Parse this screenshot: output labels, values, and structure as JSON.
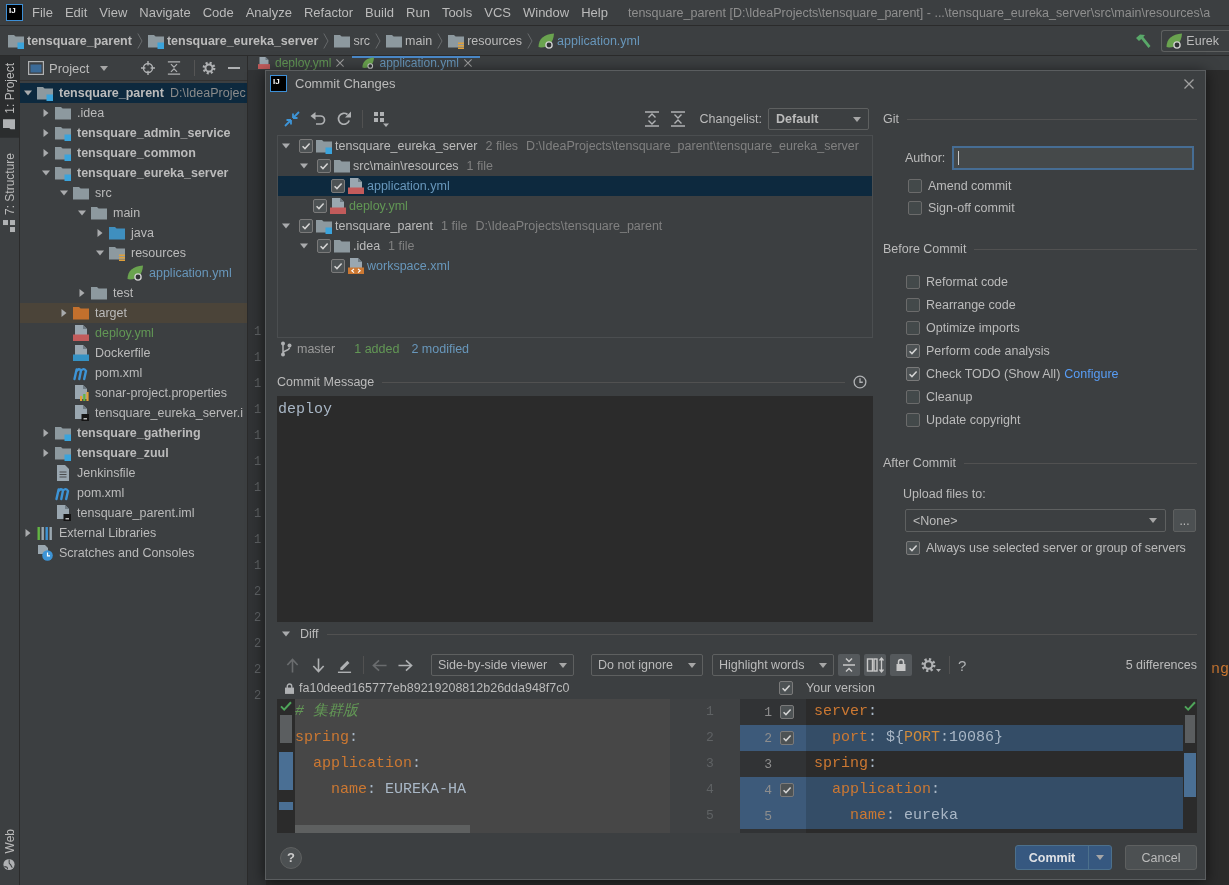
{
  "menu_bar": {
    "logo": "IJ",
    "items": [
      "File",
      "Edit",
      "View",
      "Navigate",
      "Code",
      "Analyze",
      "Refactor",
      "Build",
      "Run",
      "Tools",
      "VCS",
      "Window",
      "Help"
    ],
    "title": "tensquare_parent [D:\\IdeaProjects\\tensquare_parent] - ...\\tensquare_eureka_server\\src\\main\\resources\\a"
  },
  "navigation_bar": {
    "crumbs": [
      {
        "label": "tensquare_parent",
        "kind": "module"
      },
      {
        "label": "tensquare_eureka_server",
        "kind": "module"
      },
      {
        "label": "src",
        "kind": "folder"
      },
      {
        "label": "main",
        "kind": "folder"
      },
      {
        "label": "resources",
        "kind": "resources-folder"
      },
      {
        "label": "application.yml",
        "kind": "spring-yml",
        "color": "#6897bb"
      }
    ],
    "run_config": "Eurek"
  },
  "tool_strip": {
    "top": [
      {
        "label": "1: Project",
        "kind": "project",
        "selected": true
      },
      {
        "label": "7: Structure",
        "kind": "structure",
        "selected": false
      }
    ],
    "bottom": [
      {
        "label": "Web",
        "kind": "web",
        "selected": false
      }
    ]
  },
  "project": {
    "title": "Project",
    "tree": [
      {
        "label": "tensquare_parent",
        "kind": "module",
        "note": "D:\\IdeaProjec",
        "expanded": true,
        "selected": true,
        "children": [
          {
            "label": ".idea",
            "kind": "folder",
            "expanded": false,
            "selected": false
          },
          {
            "label": "tensquare_admin_service",
            "kind": "module",
            "expanded": false,
            "selected": false
          },
          {
            "label": "tensquare_common",
            "kind": "module",
            "expanded": false,
            "selected": false
          },
          {
            "label": "tensquare_eureka_server",
            "kind": "module",
            "expanded": true,
            "selected": false,
            "children": [
              {
                "label": "src",
                "kind": "folder",
                "expanded": true,
                "selected": false,
                "children": [
                  {
                    "label": "main",
                    "kind": "folder",
                    "expanded": true,
                    "selected": false,
                    "children": [
                      {
                        "label": "java",
                        "kind": "source-folder",
                        "expanded": false,
                        "selected": false
                      },
                      {
                        "label": "resources",
                        "kind": "resources-folder",
                        "expanded": true,
                        "selected": false,
                        "children": [
                          {
                            "label": "application.yml",
                            "kind": "spring-yml",
                            "color": "#6897bb",
                            "selected": false
                          }
                        ]
                      }
                    ]
                  },
                  {
                    "label": "test",
                    "kind": "folder",
                    "expanded": false,
                    "selected": false
                  }
                ]
              },
              {
                "label": "target",
                "kind": "excluded-folder",
                "expanded": false,
                "selected": false
              },
              {
                "label": "deploy.yml",
                "kind": "yml",
                "color": "#629755",
                "selected": false
              },
              {
                "label": "Dockerfile",
                "kind": "docker",
                "selected": false
              },
              {
                "label": "pom.xml",
                "kind": "maven",
                "selected": false
              },
              {
                "label": "sonar-project.properties",
                "kind": "properties",
                "selected": false
              },
              {
                "label": "tensquare_eureka_server.i",
                "kind": "iml",
                "selected": false
              }
            ]
          },
          {
            "label": "tensquare_gathering",
            "kind": "module",
            "expanded": false,
            "selected": false
          },
          {
            "label": "tensquare_zuul",
            "kind": "module",
            "expanded": false,
            "selected": false
          },
          {
            "label": "Jenkinsfile",
            "kind": "text",
            "selected": false
          },
          {
            "label": "pom.xml",
            "kind": "maven",
            "selected": false
          },
          {
            "label": "tensquare_parent.iml",
            "kind": "iml",
            "selected": false
          }
        ]
      },
      {
        "label": "External Libraries",
        "kind": "libraries",
        "expanded": false,
        "selected": false
      },
      {
        "label": "Scratches and Consoles",
        "kind": "scratches",
        "selected": false
      }
    ]
  },
  "editor": {
    "tabs": [
      {
        "label": "deploy.yml",
        "kind": "yml",
        "color": "#629755",
        "selected": false
      },
      {
        "label": "application.yml",
        "kind": "spring-yml",
        "color": "#6897bb",
        "selected": true
      }
    ],
    "lines": [
      {
        "number": "1"
      },
      {
        "number": "1"
      },
      {
        "number": "1"
      },
      {
        "number": "1"
      },
      {
        "number": "1"
      },
      {
        "number": "1"
      },
      {
        "number": "1"
      },
      {
        "number": "1"
      },
      {
        "number": "1"
      },
      {
        "number": "1"
      },
      {
        "number": "2"
      },
      {
        "number": "2"
      },
      {
        "number": "2"
      },
      {
        "number": "2",
        "code": "ng"
      },
      {
        "number": "2"
      }
    ]
  },
  "dialog": {
    "logo": "IJ",
    "title": "Commit Changes",
    "changelist_label": "Changelist:",
    "changelist": "Default",
    "changes_tree": [
      {
        "label": "tensquare_eureka_server",
        "kind": "module",
        "count": "2 files",
        "path": "D:\\IdeaProjects\\tensquare_parent\\tensquare_eureka_server",
        "checked": true,
        "expanded": true,
        "selected": false,
        "children": [
          {
            "label": "src\\main\\resources",
            "kind": "folder",
            "count": "1 file",
            "checked": true,
            "expanded": true,
            "selected": false,
            "children": [
              {
                "label": "application.yml",
                "kind": "yml",
                "color": "#6897bb",
                "checked": true,
                "selected": true
              }
            ]
          },
          {
            "label": "deploy.yml",
            "kind": "yml",
            "color": "#629755",
            "checked": true,
            "selected": false
          }
        ]
      },
      {
        "label": "tensquare_parent",
        "kind": "module",
        "count": "1 file",
        "path": "D:\\IdeaProjects\\tensquare_parent",
        "checked": true,
        "expanded": true,
        "selected": false,
        "children": [
          {
            "label": ".idea",
            "kind": "folder",
            "count": "1 file",
            "checked": true,
            "expanded": true,
            "selected": false,
            "children": [
              {
                "label": "workspace.xml",
                "kind": "xml",
                "color": "#6897bb",
                "checked": true,
                "selected": false
              }
            ]
          }
        ]
      }
    ],
    "branch": "master",
    "added": "1 added",
    "modified": "2 modified",
    "message_label": "Commit Message",
    "message": "deploy",
    "git": {
      "heading": "Git",
      "author": {
        "label": "Author:",
        "focused": true
      },
      "options": [
        {
          "label": "Amend commit",
          "checked": false
        },
        {
          "label": "Sign-off commit",
          "checked": false
        }
      ]
    },
    "before_commit": {
      "heading": "Before Commit",
      "options": [
        {
          "label": "Reformat code",
          "checked": false
        },
        {
          "label": "Rearrange code",
          "checked": false
        },
        {
          "label": "Optimize imports",
          "checked": false
        },
        {
          "label": "Perform code analysis",
          "checked": true
        },
        {
          "label": "Check TODO (Show All)",
          "checked": true,
          "link": "Configure"
        },
        {
          "label": "Cleanup",
          "checked": false
        },
        {
          "label": "Update copyright",
          "checked": false
        }
      ]
    },
    "after_commit": {
      "heading": "After Commit",
      "upload_label": "Upload files to:",
      "upload_target": "<None>",
      "browse": "...",
      "options": [
        {
          "label": "Always use selected server or group of servers",
          "checked": true
        }
      ]
    },
    "diff": {
      "heading": "Diff",
      "expanded": true,
      "nav": [
        {
          "kind": "previous",
          "disabled": true
        },
        {
          "kind": "next",
          "disabled": false
        },
        {
          "kind": "edit",
          "disabled": false
        },
        {
          "kind": "back",
          "disabled": true
        },
        {
          "kind": "forward",
          "disabled": false
        }
      ],
      "viewer": "Side-by-side viewer",
      "ignore": "Do not ignore",
      "highlight": "Highlight words",
      "toggles": [
        {
          "kind": "collapse-unchanged",
          "on": true
        },
        {
          "kind": "sync-scroll",
          "on": true
        },
        {
          "kind": "lock",
          "on": true
        }
      ],
      "help": "?",
      "count": "5 differences",
      "left_title": "fa10deed165777eb89219208812b26dda948f7c0",
      "right_title": "Your version",
      "right_checked": true,
      "left_lines": [
        {
          "number": "1",
          "tokens": [
            {
              "text": "# 集群版",
              "kind": "comment"
            }
          ]
        },
        {
          "number": "2",
          "tokens": [
            {
              "text": "spring",
              "kind": "key"
            },
            {
              "text": ":",
              "kind": "plain"
            }
          ]
        },
        {
          "number": "3",
          "tokens": [
            {
              "text": "  application",
              "kind": "key"
            },
            {
              "text": ":",
              "kind": "plain"
            }
          ]
        },
        {
          "number": "4",
          "tokens": [
            {
              "text": "    name",
              "kind": "key"
            },
            {
              "text": ": EUREKA-HA",
              "kind": "plain"
            }
          ]
        },
        {
          "number": "5"
        }
      ],
      "right_lines": [
        {
          "number": "1",
          "checked": true,
          "changed": false,
          "tokens": [
            {
              "text": "server",
              "kind": "key"
            },
            {
              "text": ":",
              "kind": "plain"
            }
          ]
        },
        {
          "number": "2",
          "checked": true,
          "changed": true,
          "tokens": [
            {
              "text": "  port",
              "kind": "key"
            },
            {
              "text": ": ${",
              "kind": "plain"
            },
            {
              "text": "PORT",
              "kind": "variable"
            },
            {
              "text": ":10086}",
              "kind": "plain"
            }
          ]
        },
        {
          "number": "3",
          "changed": false,
          "tokens": [
            {
              "text": "spring",
              "kind": "key"
            },
            {
              "text": ":",
              "kind": "plain"
            }
          ]
        },
        {
          "number": "4",
          "checked": true,
          "changed": true,
          "tokens": [
            {
              "text": "  application",
              "kind": "key"
            },
            {
              "text": ":",
              "kind": "plain"
            }
          ]
        },
        {
          "number": "5",
          "changed": true,
          "tokens": [
            {
              "text": "    name",
              "kind": "key"
            },
            {
              "text": ": eureka",
              "kind": "plain"
            }
          ]
        }
      ]
    },
    "help": "?",
    "buttons": [
      {
        "label": "Commit",
        "kind": "primary"
      },
      {
        "label": "Cancel",
        "kind": "secondary"
      }
    ]
  }
}
